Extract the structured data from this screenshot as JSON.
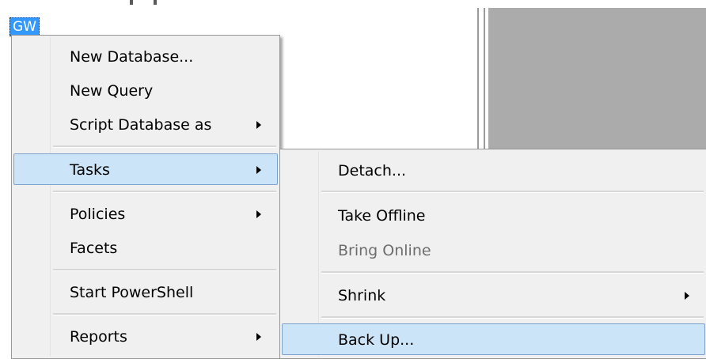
{
  "tree": {
    "node_label": "GW"
  },
  "context_menu": {
    "items": [
      {
        "label": "New Database...",
        "has_submenu": false,
        "selected": false,
        "disabled": false
      },
      {
        "label": "New Query",
        "has_submenu": false,
        "selected": false,
        "disabled": false
      },
      {
        "label": "Script Database as",
        "has_submenu": true,
        "selected": false,
        "disabled": false
      },
      {
        "label": "Tasks",
        "has_submenu": true,
        "selected": true,
        "disabled": false
      },
      {
        "label": "Policies",
        "has_submenu": true,
        "selected": false,
        "disabled": false
      },
      {
        "label": "Facets",
        "has_submenu": false,
        "selected": false,
        "disabled": false
      },
      {
        "label": "Start PowerShell",
        "has_submenu": false,
        "selected": false,
        "disabled": false
      },
      {
        "label": "Reports",
        "has_submenu": true,
        "selected": false,
        "disabled": false
      }
    ]
  },
  "tasks_submenu": {
    "items": [
      {
        "label": "Detach...",
        "has_submenu": false,
        "selected": false,
        "disabled": false
      },
      {
        "label": "Take Offline",
        "has_submenu": false,
        "selected": false,
        "disabled": false
      },
      {
        "label": "Bring Online",
        "has_submenu": false,
        "selected": false,
        "disabled": true
      },
      {
        "label": "Shrink",
        "has_submenu": true,
        "selected": false,
        "disabled": false
      },
      {
        "label": "Back Up...",
        "has_submenu": false,
        "selected": true,
        "disabled": false
      }
    ]
  },
  "colors": {
    "selection_fill": "#cce4f7",
    "selection_border": "#7da2ce",
    "node_highlight": "#3399ff",
    "menu_background": "#f0f0f0",
    "disabled_text": "#6d6d6d"
  }
}
